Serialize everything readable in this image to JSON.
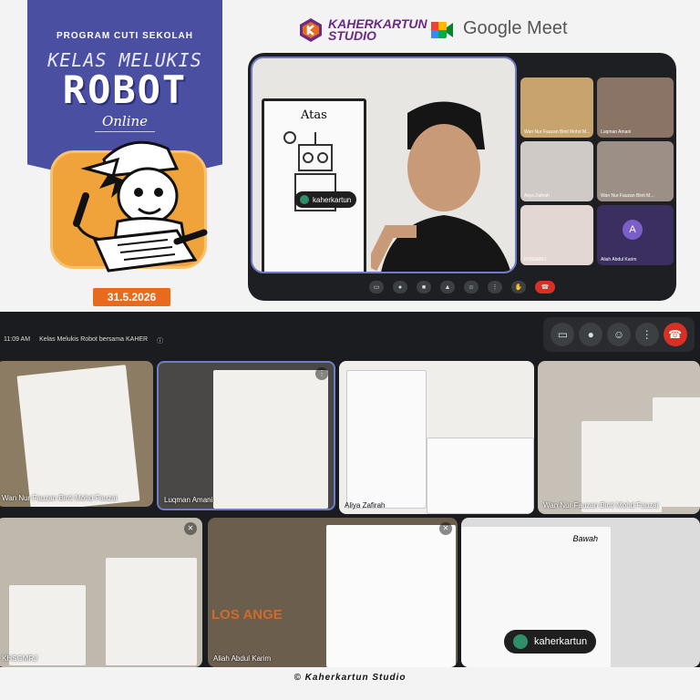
{
  "poster": {
    "program": "PROGRAM CUTI SEKOLAH",
    "title_line1": "KELAS MELUKIS",
    "title_line2": "ROBOT",
    "subtitle": "Online",
    "date": "31.5.2026"
  },
  "logos": {
    "brand_line1": "KAHERKARTUN",
    "brand_line2": "STUDIO",
    "meet": "Google Meet"
  },
  "meet_top": {
    "host_name": "kaherkartun",
    "board_text": "Atas",
    "participants": [
      {
        "name": "Wan Nur Fauzan Binti Mohd M..."
      },
      {
        "name": "Luqman Amani"
      },
      {
        "name": "Aliya Zafirah"
      },
      {
        "name": "Wan Nur Fauzan Binti M..."
      },
      {
        "name": "KHSGMRJ"
      },
      {
        "name": "Aliah Abdul Karim",
        "initial": "A"
      }
    ]
  },
  "meet_bottom": {
    "time": "11:09 AM",
    "meeting_title": "Kelas Melukis Robot bersama KAHER",
    "participants": [
      {
        "name": "Wan Nur Fauzan Binti Mohd Fauzai"
      },
      {
        "name": "Luqman Amani"
      },
      {
        "name": "Aliya Zafirah"
      },
      {
        "name": "Wan Nur Fauzan Binti Mohd Fauzai"
      },
      {
        "name": "KHSGMRJ"
      },
      {
        "name": "Aliah Abdul Karim"
      },
      {
        "name": "kaherkartun"
      }
    ],
    "shirt_text": "LOS ANGE",
    "paper_word": "Bawah"
  },
  "footer": {
    "copyright": "© Kaherkartun Studio"
  },
  "colors": {
    "poster_bg": "#4b4fa1",
    "accent_orange": "#e86b1d",
    "meet_red": "#d93025"
  }
}
